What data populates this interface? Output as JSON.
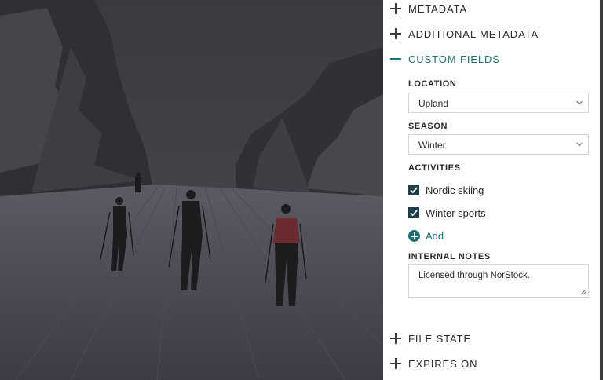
{
  "sections": {
    "metadata": "METADATA",
    "additional_metadata": "ADDITIONAL METADATA",
    "custom_fields": "CUSTOM FIELDS",
    "file_state": "FILE STATE",
    "expires_on": "EXPIRES ON"
  },
  "custom_fields": {
    "location": {
      "label": "LOCATION",
      "value": "Upland"
    },
    "season": {
      "label": "SEASON",
      "value": "Winter"
    },
    "activities": {
      "label": "ACTIVITIES",
      "items": [
        {
          "label": "Nordic skiing",
          "checked": true
        },
        {
          "label": "Winter sports",
          "checked": true
        }
      ],
      "add_label": "Add"
    },
    "internal_notes": {
      "label": "INTERNAL NOTES",
      "value": "Licensed through NorStock."
    }
  },
  "colors": {
    "accent": "#1f6e74",
    "checkbox": "#1d3f49",
    "panel_background": "#ffffff",
    "photo_overlay": "#2f2f31"
  },
  "icons": {
    "collapsed": "plus-icon",
    "expanded": "minus-icon",
    "select": "chevron-down-icon",
    "checkbox": "checkmark-icon",
    "add": "plus-circle-icon"
  }
}
